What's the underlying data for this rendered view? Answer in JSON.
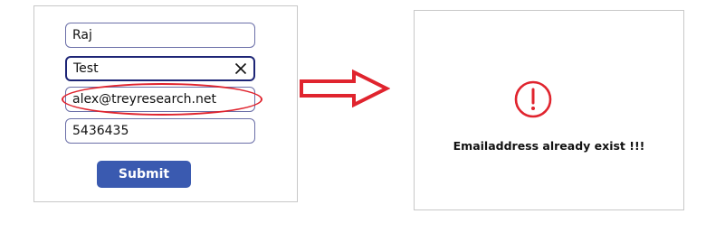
{
  "form": {
    "fields": [
      {
        "name": "first-name-field",
        "value": "Raj"
      },
      {
        "name": "last-name-field",
        "value": "Test"
      },
      {
        "name": "email-field",
        "value": "alex@treyresearch.net"
      },
      {
        "name": "phone-field",
        "value": "5436435"
      }
    ],
    "submit_label": "Submit"
  },
  "message": {
    "text": "Emailaddress already exist !!!"
  },
  "colors": {
    "highlight": "#e0242e",
    "arrow": "#e0242e",
    "error_icon": "#e0242e",
    "submit_bg": "#3a5ab0",
    "focused_border": "#1d2576"
  },
  "icons": {
    "clear": "close-icon",
    "arrow": "right-arrow-icon",
    "error": "exclamation-circle-icon"
  }
}
